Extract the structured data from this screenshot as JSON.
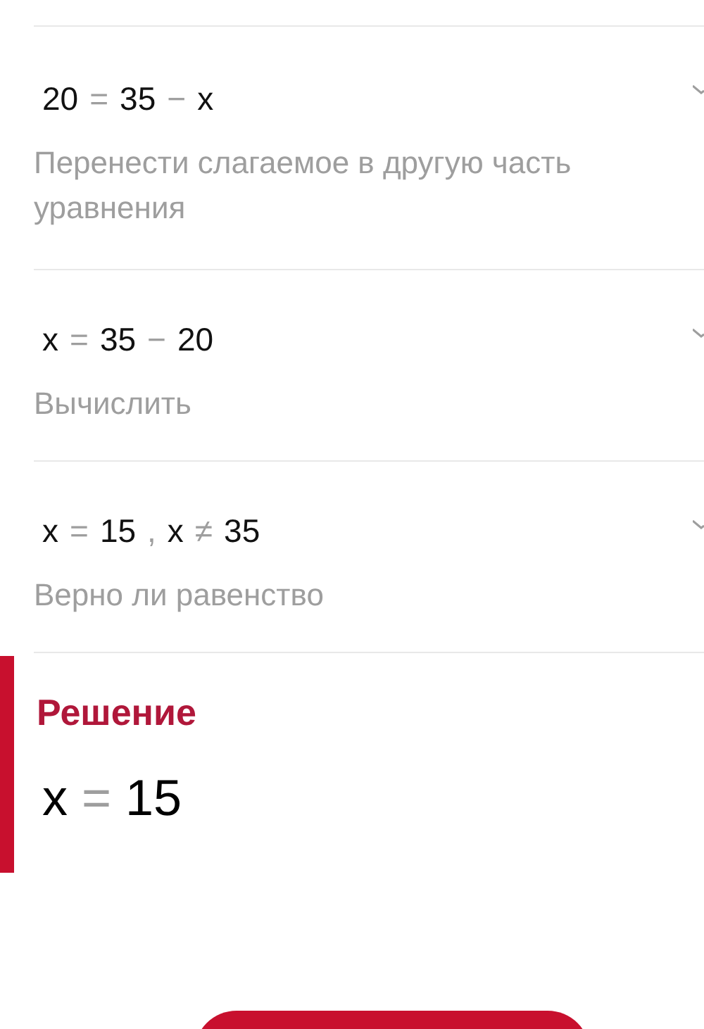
{
  "steps": [
    {
      "expanded": false,
      "equation": [
        {
          "kind": "term",
          "text": "20"
        },
        {
          "kind": "op",
          "text": "="
        },
        {
          "kind": "term",
          "text": "35"
        },
        {
          "kind": "op",
          "text": "−"
        },
        {
          "kind": "term",
          "text": "x"
        }
      ],
      "description": "Перенести слагаемое в другую часть уравнения"
    },
    {
      "expanded": false,
      "equation": [
        {
          "kind": "term",
          "text": "x"
        },
        {
          "kind": "op",
          "text": "="
        },
        {
          "kind": "term",
          "text": "35"
        },
        {
          "kind": "op",
          "text": "−"
        },
        {
          "kind": "term",
          "text": "20"
        }
      ],
      "description": "Вычислить"
    },
    {
      "expanded": false,
      "equation": [
        {
          "kind": "term",
          "text": "x"
        },
        {
          "kind": "op",
          "text": "="
        },
        {
          "kind": "term",
          "text": "15"
        },
        {
          "kind": "op",
          "text": ","
        },
        {
          "kind": "term",
          "text": "x"
        },
        {
          "kind": "op",
          "text": "≠"
        },
        {
          "kind": "term",
          "text": "35"
        }
      ],
      "description": "Верно ли равенство"
    }
  ],
  "solution": {
    "title": "Решение",
    "equation": [
      {
        "kind": "term",
        "text": "x"
      },
      {
        "kind": "op",
        "text": "="
      },
      {
        "kind": "term",
        "text": "15"
      }
    ]
  }
}
